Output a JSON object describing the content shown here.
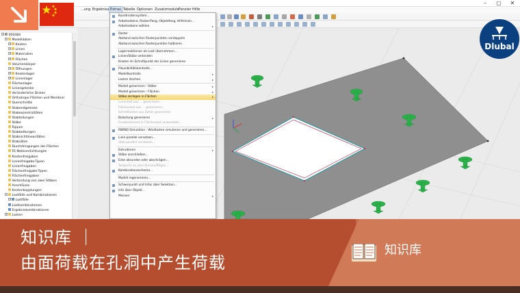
{
  "menubar": {
    "items": [
      "...ung",
      "Ergebnisse",
      "Extras",
      "Tabelle",
      "Optionen",
      "Zusatzmodule",
      "Fenster",
      "Hilfe"
    ]
  },
  "navigator": {
    "rows": [
      {
        "label": "000484",
        "level": 0,
        "kind": "gray",
        "exp": "−"
      },
      {
        "label": "Modelldaten",
        "level": 1,
        "kind": "folder",
        "exp": "−"
      },
      {
        "label": "Knoten",
        "level": 2,
        "kind": "folder",
        "exp": "+"
      },
      {
        "label": "Linien",
        "level": 2,
        "kind": "folder",
        "exp": "+"
      },
      {
        "label": "Materialien",
        "level": 2,
        "kind": "folder",
        "exp": "+"
      },
      {
        "label": "Flächen",
        "level": 2,
        "kind": "folder",
        "exp": "+"
      },
      {
        "label": "Volumenkörper",
        "level": 2,
        "kind": "folder",
        "exp": ""
      },
      {
        "label": "Öffnungen",
        "level": 2,
        "kind": "folder",
        "exp": "+"
      },
      {
        "label": "Knotenlager",
        "level": 2,
        "kind": "folder",
        "exp": "+"
      },
      {
        "label": "Linienlager",
        "level": 2,
        "kind": "folder",
        "exp": "+"
      },
      {
        "label": "Flächenlager",
        "level": 2,
        "kind": "folder",
        "exp": ""
      },
      {
        "label": "Liniengelenke",
        "level": 2,
        "kind": "folder",
        "exp": ""
      },
      {
        "label": "Veränderliche Dicken",
        "level": 2,
        "kind": "folder",
        "exp": ""
      },
      {
        "label": "Orthotrope Flächen und Membrar",
        "level": 2,
        "kind": "folder",
        "exp": ""
      },
      {
        "label": "Querschnitte",
        "level": 2,
        "kind": "folder",
        "exp": ""
      },
      {
        "label": "Stabendgelenke",
        "level": 2,
        "kind": "folder",
        "exp": ""
      },
      {
        "label": "Stabexzentrizitäten",
        "level": 2,
        "kind": "folder",
        "exp": ""
      },
      {
        "label": "Stabteilungen",
        "level": 2,
        "kind": "folder",
        "exp": ""
      },
      {
        "label": "Stäbe",
        "level": 2,
        "kind": "folder",
        "exp": ""
      },
      {
        "label": "Rippen",
        "level": 2,
        "kind": "folder",
        "exp": ""
      },
      {
        "label": "Stabbettungen",
        "level": 2,
        "kind": "folder",
        "exp": ""
      },
      {
        "label": "Stabnichtlinearitäten",
        "level": 2,
        "kind": "folder",
        "exp": ""
      },
      {
        "label": "Stabsätze",
        "level": 2,
        "kind": "folder",
        "exp": ""
      },
      {
        "label": "Durchdringungen der Flächen",
        "level": 2,
        "kind": "folder",
        "exp": ""
      },
      {
        "label": "FE-Netzverdichtungen",
        "level": 2,
        "kind": "folder",
        "exp": ""
      },
      {
        "label": "Knotenfreigaben",
        "level": 2,
        "kind": "folder",
        "exp": ""
      },
      {
        "label": "Linienfreigabe-Typen",
        "level": 2,
        "kind": "folder",
        "exp": ""
      },
      {
        "label": "Linienfreigaben",
        "level": 2,
        "kind": "folder",
        "exp": ""
      },
      {
        "label": "Flächenfreigabe-Typen",
        "level": 2,
        "kind": "folder",
        "exp": ""
      },
      {
        "label": "Flächenfreigaben",
        "level": 2,
        "kind": "folder",
        "exp": ""
      },
      {
        "label": "Verbindung von zwei Stäben",
        "level": 2,
        "kind": "folder",
        "exp": ""
      },
      {
        "label": "Anschlüsse",
        "level": 2,
        "kind": "folder",
        "exp": ""
      },
      {
        "label": "Knotenkopplungen",
        "level": 2,
        "kind": "folder",
        "exp": ""
      },
      {
        "label": "Lastfälle und Kombinationen",
        "level": 1,
        "kind": "folder",
        "exp": "−"
      },
      {
        "label": "Lastfälle",
        "level": 2,
        "kind": "item",
        "exp": "+"
      },
      {
        "label": "Lastkombinationen",
        "level": 2,
        "kind": "item",
        "exp": ""
      },
      {
        "label": "Ergebniskombinationen",
        "level": 2,
        "kind": "item",
        "exp": ""
      },
      {
        "label": "Lasten",
        "level": 1,
        "kind": "folder",
        "exp": "+"
      }
    ]
  },
  "menu": {
    "items": [
      {
        "label": "Koordinatensystem...",
        "type": "item",
        "icon": true
      },
      {
        "label": "Arbeitsebene, Raster/Fang, Objektfang, Hilfslinien...",
        "type": "item",
        "icon": true
      },
      {
        "label": "Arbeitsebene wählen",
        "type": "item",
        "arrow": true
      },
      {
        "type": "sep"
      },
      {
        "label": "Raster",
        "type": "item",
        "icon": true
      },
      {
        "label": "Abstand zwischen Rasterpunkten verdoppeln",
        "type": "item"
      },
      {
        "label": "Abstand zwischen Rasterpunkten halbieren",
        "type": "item"
      },
      {
        "type": "sep"
      },
      {
        "label": "Lagerreaktionen als Last übernehmen...",
        "type": "item"
      },
      {
        "label": "Linien/Stäbe verbinden",
        "type": "item",
        "icon": true
      },
      {
        "label": "Knoten im Schnittpunkt der Linien generieren",
        "type": "item"
      },
      {
        "type": "sep"
      },
      {
        "label": "Plausibilitätskontrolle...",
        "type": "item",
        "icon": true
      },
      {
        "label": "Modellkontrolle",
        "type": "item",
        "arrow": true
      },
      {
        "label": "Lasten löschen",
        "type": "item",
        "arrow": true
      },
      {
        "type": "sep"
      },
      {
        "label": "Modell generieren - Stäbe",
        "type": "item",
        "arrow": true
      },
      {
        "label": "Modell generieren - Flächen",
        "type": "item",
        "arrow": true
      },
      {
        "label": "Stäbe zerlegen in Flächen",
        "type": "item",
        "arrow": true,
        "highlight": true
      },
      {
        "label": "Linienlast aus ... generieren...",
        "type": "item",
        "disabled": true
      },
      {
        "label": "Flächenlast aus ... generieren...",
        "type": "item",
        "disabled": true
      },
      {
        "label": "Schnittlasten aus Zellen generieren",
        "type": "item",
        "disabled": true
      },
      {
        "label": "Belastung generieren",
        "type": "item",
        "arrow": true
      },
      {
        "label": "Ersatzmoment in Flächenlast umwandeln...",
        "type": "item",
        "disabled": true
      },
      {
        "type": "sep"
      },
      {
        "label": "RWIND Simulation - Windlasten simulieren und generieren...",
        "type": "item",
        "icon": true
      },
      {
        "type": "sep"
      },
      {
        "label": "Linie parallel versetzen...",
        "type": "item",
        "icon": true
      },
      {
        "label": "Stab parallel versetzen...",
        "type": "item",
        "disabled": true
      },
      {
        "type": "sep"
      },
      {
        "label": "Extrudieren",
        "type": "item",
        "arrow": true
      },
      {
        "label": "Stäbe anschließen...",
        "type": "item",
        "icon": true
      },
      {
        "label": "Ecke abrunden oder abschrägen...",
        "type": "item",
        "icon": true
      },
      {
        "label": "Tangente zu zwei Kreisen/Bögen...",
        "type": "item",
        "disabled": true
      },
      {
        "label": "Kombinationsschema...",
        "type": "item",
        "icon": true
      },
      {
        "type": "sep"
      },
      {
        "label": "Modell regenerieren...",
        "type": "item"
      },
      {
        "type": "sep"
      },
      {
        "label": "Schwerpunkt und Infos über Selektion...",
        "type": "item",
        "icon": true
      },
      {
        "label": "Info über Objekt...",
        "type": "item",
        "icon": true
      },
      {
        "label": "Messen",
        "type": "item",
        "arrow": true
      }
    ]
  },
  "logo": {
    "text": "Dlubal"
  },
  "banner": {
    "line1": "知识库 ｜",
    "line2": "由面荷载在孔洞中产生荷载",
    "right_label": "知识库"
  },
  "colors": {
    "accent_orange": "#ef7b4f",
    "banner": "#b54e2e",
    "logo": "#0a3f80",
    "support_green": "#2bb14a"
  }
}
